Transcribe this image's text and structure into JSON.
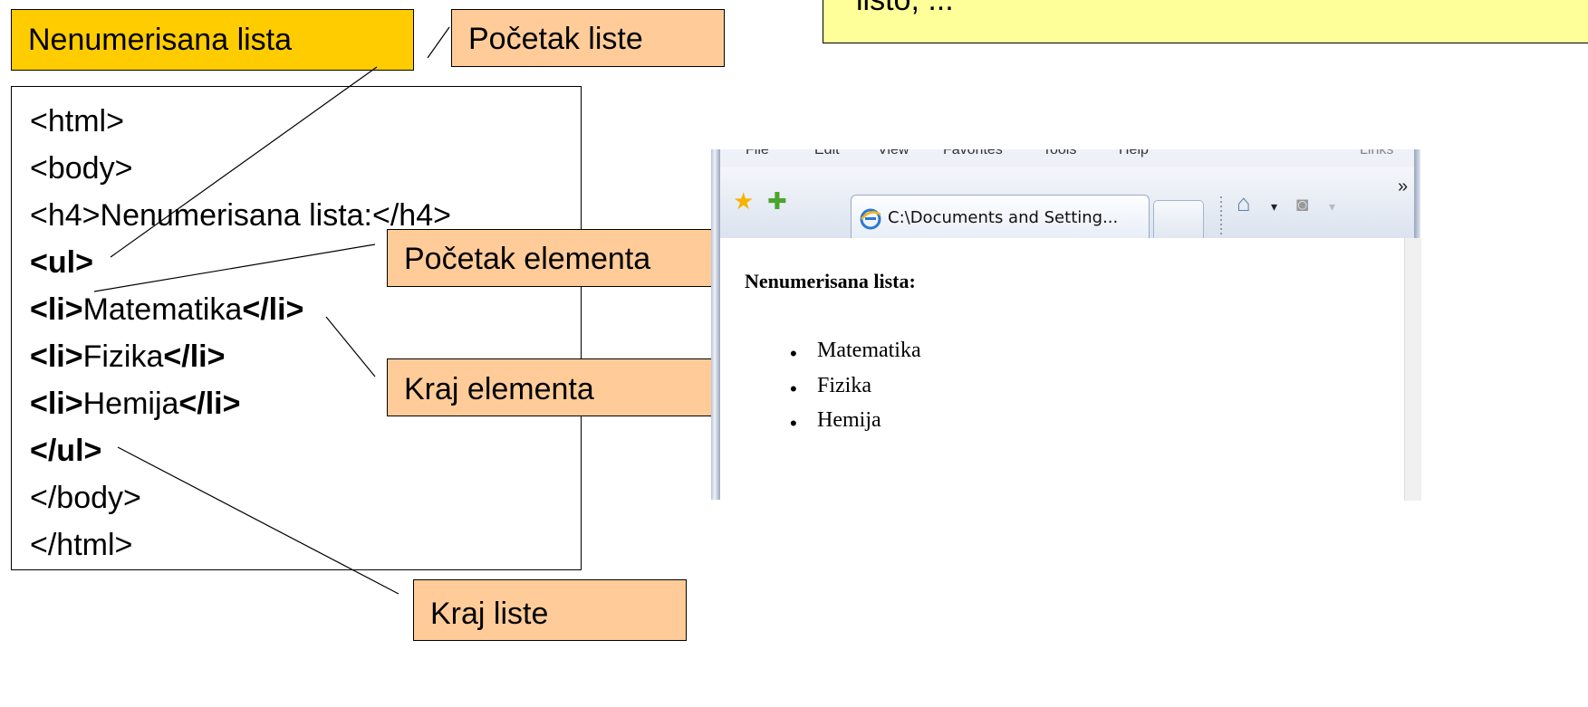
{
  "top_note": {
    "text": "listo, ..."
  },
  "title_box": {
    "label": "Nenumerisana lista"
  },
  "callouts": {
    "list_start": "Početak liste",
    "element_start": "Početak elementa",
    "element_end": "Kraj elementa",
    "list_end": "Kraj liste"
  },
  "code": {
    "line1": "<html>",
    "line2": "<body>",
    "line3": "<h4>Nenumerisana lista:</h4>",
    "line4": "<ul>",
    "line5_open": "<li>",
    "line5_text": "Matematika",
    "line5_close": "</li>",
    "line6_open": "<li>",
    "line6_text": "Fizika",
    "line6_close": "</li>",
    "line7_open": "<li>",
    "line7_text": "Hemija",
    "line7_close": "</li>",
    "line8": "</ul>",
    "line9": "</body>",
    "line10": "</html>"
  },
  "browser": {
    "menu": [
      "File",
      "Edit",
      "View",
      "Favorites",
      "Tools",
      "Help",
      "Links"
    ],
    "tab_title": "C:\\Documents and Setting...",
    "page_heading": "Nenumerisana lista:",
    "page_items": [
      "Matematika",
      "Fizika",
      "Hemija"
    ],
    "toolbar_icons": [
      "favorites-star-icon",
      "add-favorite-icon",
      "home-icon",
      "rss-feed-icon"
    ]
  }
}
